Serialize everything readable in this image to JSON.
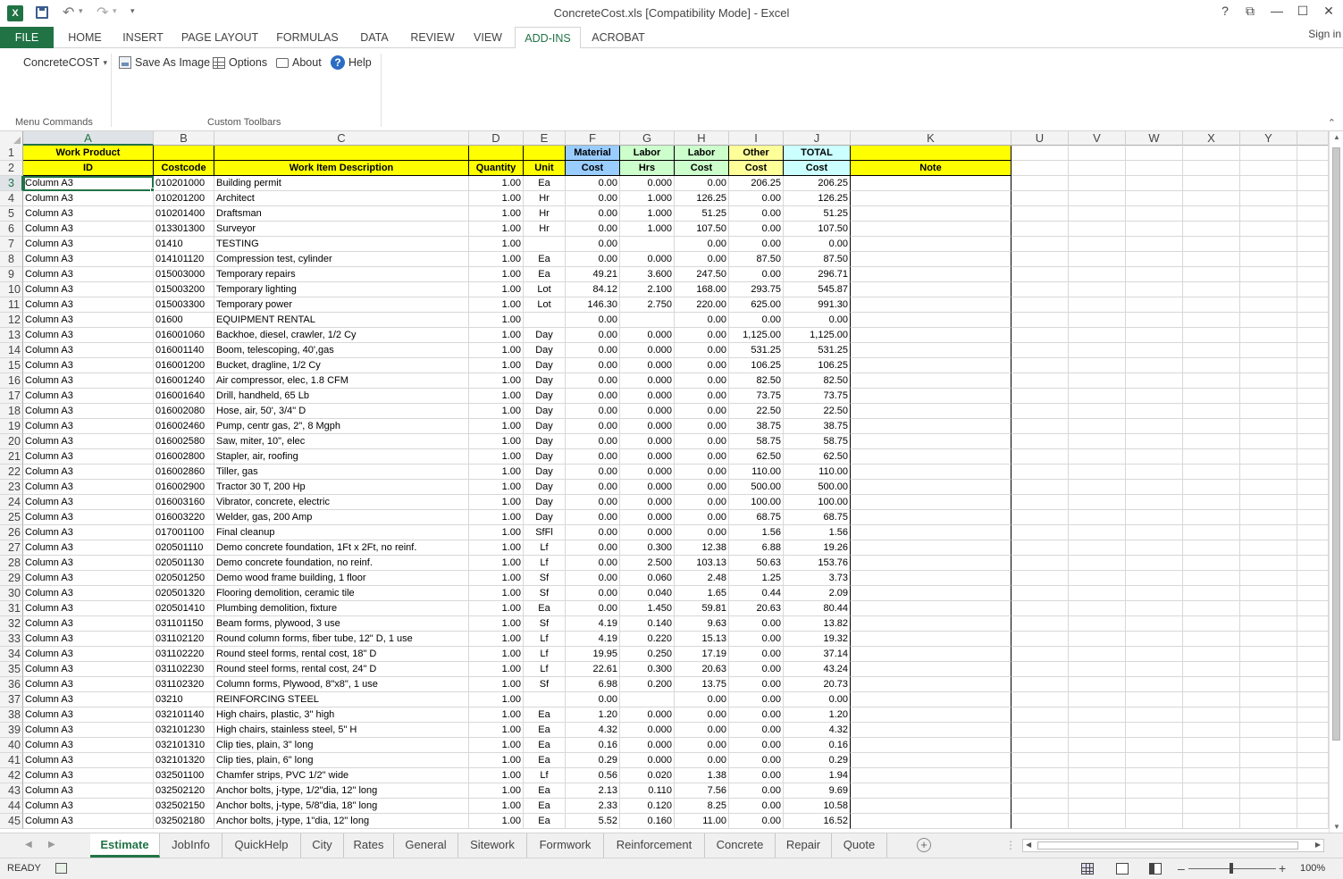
{
  "titlebar": {
    "doc_title": "ConcreteCost.xls  [Compatibility Mode] - Excel",
    "app_icon": "excel-icon",
    "app_icon_glyph": "X",
    "undo_glyph": "↶",
    "redo_glyph": "↷",
    "dropdown_glyph": "▾",
    "customize_glyph": "▾",
    "help_glyph": "?",
    "restore_ribbon_glyph": "⧉",
    "minimize_glyph": "—",
    "maximize_glyph": "☐",
    "close_glyph": "✕"
  },
  "ribbon_tabs": [
    "FILE",
    "HOME",
    "INSERT",
    "PAGE LAYOUT",
    "FORMULAS",
    "DATA",
    "REVIEW",
    "VIEW",
    "ADD-INS",
    "ACROBAT"
  ],
  "active_ribbon_tab": "ADD-INS",
  "signin": "Sign in",
  "ribbon": {
    "concretecost_label": "ConcreteCOST",
    "concretecost_caret": "▾",
    "save_as_image": "Save As Image",
    "options": "Options",
    "about": "About",
    "help": "Help",
    "help_glyph": "?",
    "group_menu_commands": "Menu Commands",
    "group_custom_toolbars": "Custom Toolbars",
    "collapse_glyph": "⌃"
  },
  "columns": [
    "A",
    "B",
    "C",
    "D",
    "E",
    "F",
    "G",
    "H",
    "I",
    "J",
    "K",
    "U",
    "V",
    "W",
    "X",
    "Y"
  ],
  "selected_column": "A",
  "header_row1": {
    "A": "Work Product",
    "B": "",
    "C": "",
    "D": "",
    "E": "",
    "F": "Material",
    "G": "Labor",
    "H": "Labor",
    "I": "Other",
    "J": "TOTAL",
    "K": ""
  },
  "header_row2": {
    "A": "ID",
    "B": "Costcode",
    "C": "Work Item Description",
    "D": "Quantity",
    "E": "Unit",
    "F": "Cost",
    "G": "Hrs",
    "H": "Cost",
    "I": "Cost",
    "J": "Cost",
    "K": "Note"
  },
  "rows": [
    [
      "3",
      "Column A3",
      "010201000",
      "Building permit",
      "1.00",
      "Ea",
      "0.00",
      "0.000",
      "0.00",
      "206.25",
      "206.25"
    ],
    [
      "4",
      "Column A3",
      "010201200",
      "Architect",
      "1.00",
      "Hr",
      "0.00",
      "1.000",
      "126.25",
      "0.00",
      "126.25"
    ],
    [
      "5",
      "Column A3",
      "010201400",
      "Draftsman",
      "1.00",
      "Hr",
      "0.00",
      "1.000",
      "51.25",
      "0.00",
      "51.25"
    ],
    [
      "6",
      "Column A3",
      "013301300",
      "Surveyor",
      "1.00",
      "Hr",
      "0.00",
      "1.000",
      "107.50",
      "0.00",
      "107.50"
    ],
    [
      "7",
      "Column A3",
      "01410",
      "TESTING",
      "1.00",
      "",
      "0.00",
      "",
      "0.00",
      "0.00",
      "0.00"
    ],
    [
      "8",
      "Column A3",
      "014101120",
      "Compression test, cylinder",
      "1.00",
      "Ea",
      "0.00",
      "0.000",
      "0.00",
      "87.50",
      "87.50"
    ],
    [
      "9",
      "Column A3",
      "015003000",
      "Temporary repairs",
      "1.00",
      "Ea",
      "49.21",
      "3.600",
      "247.50",
      "0.00",
      "296.71"
    ],
    [
      "10",
      "Column A3",
      "015003200",
      "Temporary lighting",
      "1.00",
      "Lot",
      "84.12",
      "2.100",
      "168.00",
      "293.75",
      "545.87"
    ],
    [
      "11",
      "Column A3",
      "015003300",
      "Temporary power",
      "1.00",
      "Lot",
      "146.30",
      "2.750",
      "220.00",
      "625.00",
      "991.30"
    ],
    [
      "12",
      "Column A3",
      "01600",
      "EQUIPMENT RENTAL",
      "1.00",
      "",
      "0.00",
      "",
      "0.00",
      "0.00",
      "0.00"
    ],
    [
      "13",
      "Column A3",
      "016001060",
      "Backhoe, diesel, crawler, 1/2 Cy",
      "1.00",
      "Day",
      "0.00",
      "0.000",
      "0.00",
      "1,125.00",
      "1,125.00"
    ],
    [
      "14",
      "Column A3",
      "016001140",
      "Boom, telescoping, 40',gas",
      "1.00",
      "Day",
      "0.00",
      "0.000",
      "0.00",
      "531.25",
      "531.25"
    ],
    [
      "15",
      "Column A3",
      "016001200",
      "Bucket, dragline, 1/2 Cy",
      "1.00",
      "Day",
      "0.00",
      "0.000",
      "0.00",
      "106.25",
      "106.25"
    ],
    [
      "16",
      "Column A3",
      "016001240",
      "Air compressor, elec, 1.8 CFM",
      "1.00",
      "Day",
      "0.00",
      "0.000",
      "0.00",
      "82.50",
      "82.50"
    ],
    [
      "17",
      "Column A3",
      "016001640",
      "Drill, handheld, 65 Lb",
      "1.00",
      "Day",
      "0.00",
      "0.000",
      "0.00",
      "73.75",
      "73.75"
    ],
    [
      "18",
      "Column A3",
      "016002080",
      "Hose, air, 50', 3/4\" D",
      "1.00",
      "Day",
      "0.00",
      "0.000",
      "0.00",
      "22.50",
      "22.50"
    ],
    [
      "19",
      "Column A3",
      "016002460",
      "Pump, centr gas, 2\", 8 Mgph",
      "1.00",
      "Day",
      "0.00",
      "0.000",
      "0.00",
      "38.75",
      "38.75"
    ],
    [
      "20",
      "Column A3",
      "016002580",
      "Saw, miter, 10\", elec",
      "1.00",
      "Day",
      "0.00",
      "0.000",
      "0.00",
      "58.75",
      "58.75"
    ],
    [
      "21",
      "Column A3",
      "016002800",
      "Stapler, air, roofing",
      "1.00",
      "Day",
      "0.00",
      "0.000",
      "0.00",
      "62.50",
      "62.50"
    ],
    [
      "22",
      "Column A3",
      "016002860",
      "Tiller, gas",
      "1.00",
      "Day",
      "0.00",
      "0.000",
      "0.00",
      "110.00",
      "110.00"
    ],
    [
      "23",
      "Column A3",
      "016002900",
      "Tractor 30 T, 200 Hp",
      "1.00",
      "Day",
      "0.00",
      "0.000",
      "0.00",
      "500.00",
      "500.00"
    ],
    [
      "24",
      "Column A3",
      "016003160",
      "Vibrator, concrete, electric",
      "1.00",
      "Day",
      "0.00",
      "0.000",
      "0.00",
      "100.00",
      "100.00"
    ],
    [
      "25",
      "Column A3",
      "016003220",
      "Welder, gas, 200 Amp",
      "1.00",
      "Day",
      "0.00",
      "0.000",
      "0.00",
      "68.75",
      "68.75"
    ],
    [
      "26",
      "Column A3",
      "017001100",
      "Final cleanup",
      "1.00",
      "SfFl",
      "0.00",
      "0.000",
      "0.00",
      "1.56",
      "1.56"
    ],
    [
      "27",
      "Column A3",
      "020501110",
      "Demo concrete foundation, 1Ft x 2Ft, no reinf.",
      "1.00",
      "Lf",
      "0.00",
      "0.300",
      "12.38",
      "6.88",
      "19.26"
    ],
    [
      "28",
      "Column A3",
      "020501130",
      "Demo concrete foundation, no reinf.",
      "1.00",
      "Lf",
      "0.00",
      "2.500",
      "103.13",
      "50.63",
      "153.76"
    ],
    [
      "29",
      "Column A3",
      "020501250",
      "Demo wood frame building, 1 floor",
      "1.00",
      "Sf",
      "0.00",
      "0.060",
      "2.48",
      "1.25",
      "3.73"
    ],
    [
      "30",
      "Column A3",
      "020501320",
      "Flooring demolition, ceramic tile",
      "1.00",
      "Sf",
      "0.00",
      "0.040",
      "1.65",
      "0.44",
      "2.09"
    ],
    [
      "31",
      "Column A3",
      "020501410",
      "Plumbing demolition, fixture",
      "1.00",
      "Ea",
      "0.00",
      "1.450",
      "59.81",
      "20.63",
      "80.44"
    ],
    [
      "32",
      "Column A3",
      "031101150",
      "Beam forms, plywood, 3 use",
      "1.00",
      "Sf",
      "4.19",
      "0.140",
      "9.63",
      "0.00",
      "13.82"
    ],
    [
      "33",
      "Column A3",
      "031102120",
      "Round column forms, fiber tube, 12\" D, 1 use",
      "1.00",
      "Lf",
      "4.19",
      "0.220",
      "15.13",
      "0.00",
      "19.32"
    ],
    [
      "34",
      "Column A3",
      "031102220",
      "Round steel forms, rental cost, 18\" D",
      "1.00",
      "Lf",
      "19.95",
      "0.250",
      "17.19",
      "0.00",
      "37.14"
    ],
    [
      "35",
      "Column A3",
      "031102230",
      "Round steel forms, rental cost, 24\" D",
      "1.00",
      "Lf",
      "22.61",
      "0.300",
      "20.63",
      "0.00",
      "43.24"
    ],
    [
      "36",
      "Column A3",
      "031102320",
      "Column forms, Plywood, 8\"x8\", 1 use",
      "1.00",
      "Sf",
      "6.98",
      "0.200",
      "13.75",
      "0.00",
      "20.73"
    ],
    [
      "37",
      "Column A3",
      "03210",
      "REINFORCING STEEL",
      "1.00",
      "",
      "0.00",
      "",
      "0.00",
      "0.00",
      "0.00"
    ],
    [
      "38",
      "Column A3",
      "032101140",
      "High chairs, plastic, 3\" high",
      "1.00",
      "Ea",
      "1.20",
      "0.000",
      "0.00",
      "0.00",
      "1.20"
    ],
    [
      "39",
      "Column A3",
      "032101230",
      "High chairs, stainless steel, 5\" H",
      "1.00",
      "Ea",
      "4.32",
      "0.000",
      "0.00",
      "0.00",
      "4.32"
    ],
    [
      "40",
      "Column A3",
      "032101310",
      "Clip ties, plain, 3\" long",
      "1.00",
      "Ea",
      "0.16",
      "0.000",
      "0.00",
      "0.00",
      "0.16"
    ],
    [
      "41",
      "Column A3",
      "032101320",
      "Clip ties, plain, 6\" long",
      "1.00",
      "Ea",
      "0.29",
      "0.000",
      "0.00",
      "0.00",
      "0.29"
    ],
    [
      "42",
      "Column A3",
      "032501100",
      "Chamfer strips, PVC 1/2\" wide",
      "1.00",
      "Lf",
      "0.56",
      "0.020",
      "1.38",
      "0.00",
      "1.94"
    ],
    [
      "43",
      "Column A3",
      "032502120",
      "Anchor bolts, j-type, 1/2\"dia, 12\" long",
      "1.00",
      "Ea",
      "2.13",
      "0.110",
      "7.56",
      "0.00",
      "9.69"
    ],
    [
      "44",
      "Column A3",
      "032502150",
      "Anchor bolts, j-type, 5/8\"dia, 18\" long",
      "1.00",
      "Ea",
      "2.33",
      "0.120",
      "8.25",
      "0.00",
      "10.58"
    ],
    [
      "45",
      "Column A3",
      "032502180",
      "Anchor bolts, j-type, 1\"dia, 12\" long",
      "1.00",
      "Ea",
      "5.52",
      "0.160",
      "11.00",
      "0.00",
      "16.52"
    ]
  ],
  "active_cell": "A3",
  "sheet_tabs": [
    "Estimate",
    "JobInfo",
    "QuickHelp",
    "City",
    "Rates",
    "General",
    "Sitework",
    "Formwork",
    "Reinforcement",
    "Concrete",
    "Repair",
    "Quote"
  ],
  "active_sheet": "Estimate",
  "sheet_nav": {
    "prev": "◀",
    "next": "▶",
    "add": "+",
    "more": "⋮"
  },
  "scroll_glyphs": {
    "up": "▲",
    "down": "▼",
    "left": "◀",
    "right": "▶"
  },
  "status": {
    "ready": "READY",
    "zoom": "100%",
    "zoom_minus": "–",
    "zoom_plus": "+"
  },
  "colors": {
    "excel_green": "#217346",
    "header_yellow": "#ffff00",
    "material_blue": "#99ccff",
    "labor_green": "#ccffcc",
    "total_cyan": "#ccffff"
  }
}
